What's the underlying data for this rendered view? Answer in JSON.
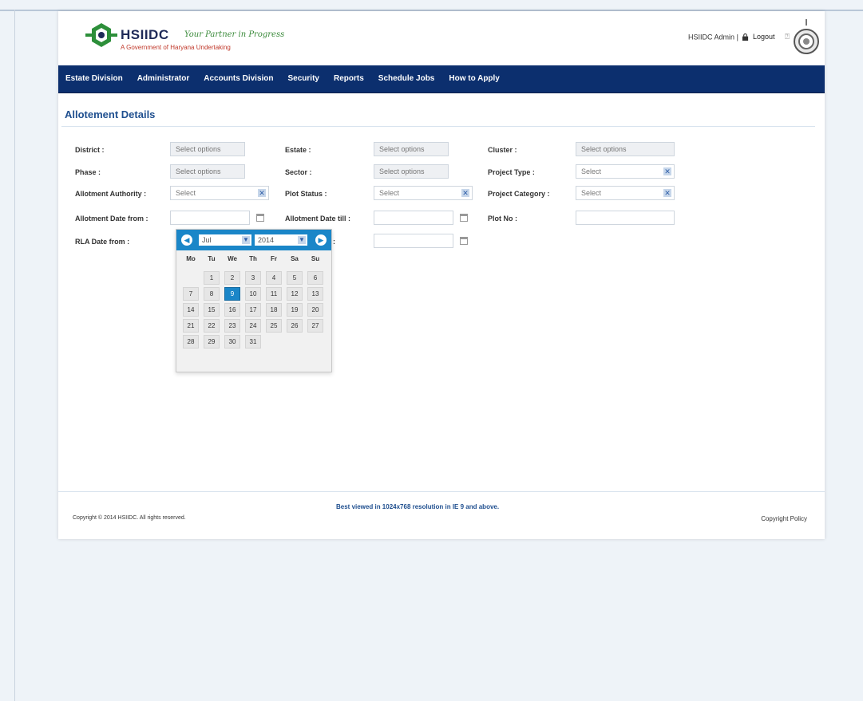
{
  "header": {
    "brand": "HSIIDC",
    "tagline": "Your Partner in Progress",
    "subtitle": "A Government of Haryana Undertaking",
    "user_name": "HSIIDC Admin",
    "separator": "|",
    "logout_label": "Logout",
    "help_glyph": "⍰"
  },
  "nav": {
    "items": [
      "Estate Division",
      "Administrator",
      "Accounts Division",
      "Security",
      "Reports",
      "Schedule Jobs",
      "How to Apply"
    ]
  },
  "page": {
    "title": "Allotement Details"
  },
  "form": {
    "district": {
      "label": "District :",
      "placeholder": "Select options"
    },
    "estate": {
      "label": "Estate :",
      "placeholder": "Select options"
    },
    "cluster": {
      "label": "Cluster :",
      "placeholder": "Select options"
    },
    "phase": {
      "label": "Phase :",
      "placeholder": "Select options"
    },
    "sector": {
      "label": "Sector :",
      "placeholder": "Select options"
    },
    "project_type": {
      "label": "Project Type :",
      "value": "Select"
    },
    "allotment_authority": {
      "label": "Allotment Authority :",
      "value": "Select"
    },
    "plot_status": {
      "label": "Plot Status :",
      "value": "Select"
    },
    "project_category": {
      "label": "Project Category :",
      "value": "Select"
    },
    "allotment_date_from": {
      "label": "Allotment Date from :",
      "value": ""
    },
    "allotment_date_till": {
      "label": "Allotment Date till :",
      "value": ""
    },
    "plot_no": {
      "label": "Plot No :",
      "value": ""
    },
    "rla_date_from": {
      "label": "RLA Date from :"
    },
    "rla_date_till": {
      "label": ":",
      "value": ""
    }
  },
  "datepicker": {
    "prev": "◀",
    "next": "▶",
    "month": "Jul",
    "year": "2014",
    "arrow": "▼",
    "weekdays": [
      "Mo",
      "Tu",
      "We",
      "Th",
      "Fr",
      "Sa",
      "Su"
    ],
    "days": [
      "1",
      "2",
      "3",
      "4",
      "5",
      "6",
      "7",
      "8",
      "9",
      "10",
      "11",
      "12",
      "13",
      "14",
      "15",
      "16",
      "17",
      "18",
      "19",
      "20",
      "21",
      "22",
      "23",
      "24",
      "25",
      "26",
      "27",
      "28",
      "29",
      "30",
      "31"
    ],
    "first_weekday_index": 1,
    "selected": "9"
  },
  "footer": {
    "copyright": "Copyright © 2014 HSIIDC. All rights reserved.",
    "best_viewed": "Best viewed in 1024x768 resolution in IE 9 and above.",
    "policy": "Copyright Policy"
  },
  "colors": {
    "nav": "#0c2f6e",
    "accent": "#1a86c8",
    "title": "#1f4f8f"
  },
  "icons": {
    "select_arrow": "✕",
    "calendar": "calendar-icon",
    "lock": "lock-icon",
    "emblem": "haryana-emblem-icon"
  }
}
